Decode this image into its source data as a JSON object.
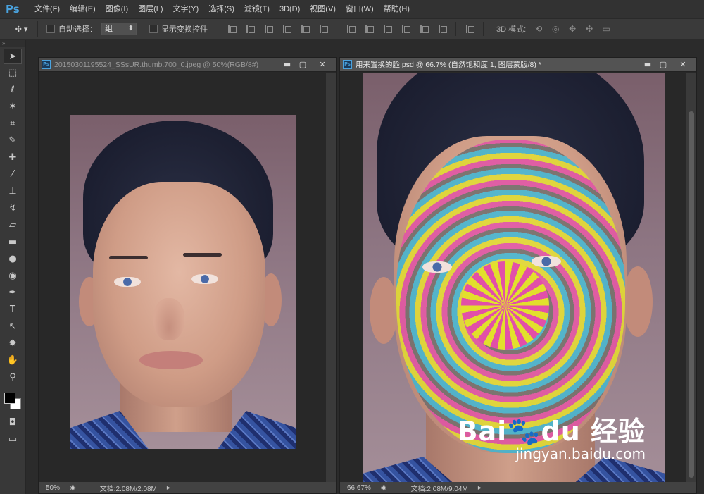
{
  "app": {
    "logo": "Ps"
  },
  "menu": [
    "文件(F)",
    "编辑(E)",
    "图像(I)",
    "图层(L)",
    "文字(Y)",
    "选择(S)",
    "滤镜(T)",
    "3D(D)",
    "视图(V)",
    "窗口(W)",
    "帮助(H)"
  ],
  "options": {
    "auto_select_label": "自动选择：",
    "auto_select_value": "组",
    "show_transform_label": "显示变换控件",
    "mode3d_label": "3D 模式:"
  },
  "tools": [
    "move-tool",
    "marquee-tool",
    "lasso-tool",
    "magic-wand-tool",
    "crop-tool",
    "eyedropper-tool",
    "healing-brush-tool",
    "brush-tool",
    "clone-stamp-tool",
    "history-brush-tool",
    "eraser-tool",
    "gradient-tool",
    "blur-tool",
    "dodge-tool",
    "pen-tool",
    "type-tool",
    "path-selection-tool",
    "custom-shape-tool",
    "hand-tool",
    "zoom-tool"
  ],
  "colors": {
    "foreground": "#000000",
    "background": "#ffffff",
    "accent": "#4aa3df"
  },
  "doc1": {
    "title": "20150301195524_SSsUR.thumb.700_0.jpeg @ 50%(RGB/8#)",
    "zoom": "50%",
    "doc_info": "文档:2.08M/2.08M"
  },
  "doc2": {
    "title": "用来置换的脸.psd @ 66.7% (自然饱和度 1, 图层蒙版/8) *",
    "zoom": "66.67%",
    "doc_info": "文档:2.08M/9.04M"
  },
  "watermark": {
    "logo": "Bai🐾du 经验",
    "url": "jingyan.baidu.com"
  }
}
